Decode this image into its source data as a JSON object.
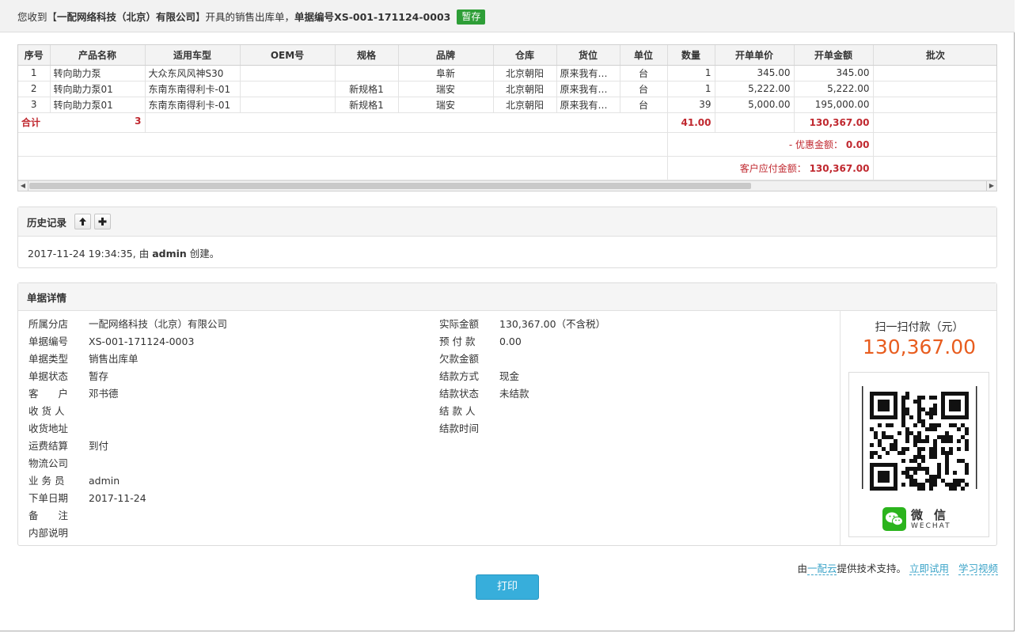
{
  "header": {
    "prefix": "您收到【",
    "company": "一配网络科技（北京）有限公司",
    "middle": "】开具的销售出库单，",
    "doc_label": "单据编号",
    "doc_no": "XS-001-171124-0003",
    "status_badge": "暂存"
  },
  "table": {
    "columns": [
      "序号",
      "产品名称",
      "适用车型",
      "OEM号",
      "规格",
      "品牌",
      "仓库",
      "货位",
      "单位",
      "数量",
      "开单单价",
      "开单金额",
      "批次"
    ],
    "rows": [
      [
        "1",
        "转向助力泵",
        "大众东风风神S30",
        "",
        "",
        "阜新",
        "北京朝阳",
        "原来我有一个",
        "台",
        "1",
        "345.00",
        "345.00",
        ""
      ],
      [
        "2",
        "转向助力泵01",
        "东南东南得利卡-01",
        "",
        "新规格1",
        "瑞安",
        "北京朝阳",
        "原来我有一个",
        "台",
        "1",
        "5,222.00",
        "5,222.00",
        ""
      ],
      [
        "3",
        "转向助力泵01",
        "东南东南得利卡-01",
        "",
        "新规格1",
        "瑞安",
        "北京朝阳",
        "原来我有一个",
        "台",
        "39",
        "5,000.00",
        "195,000.00",
        ""
      ]
    ],
    "total_label": "合计",
    "total_count": "3",
    "total_qty": "41.00",
    "total_amount": "130,367.00",
    "discount_label": "- 优惠金额：",
    "discount_value": "0.00",
    "payable_label": "客户应付金额：",
    "payable_value": "130,367.00"
  },
  "history": {
    "title": "历史记录",
    "time": "2017-11-24 19:34:35,",
    "by": "由",
    "user": "admin",
    "action": "创建。"
  },
  "detail": {
    "title": "单据详情",
    "left": [
      {
        "k": "所属分店",
        "v": "一配网络科技（北京）有限公司"
      },
      {
        "k": "单据编号",
        "v": "XS-001-171124-0003"
      },
      {
        "k": "单据类型",
        "v": "销售出库单"
      },
      {
        "k": "单据状态",
        "v": "暂存"
      },
      {
        "k": "客　　户",
        "v": "邓书德"
      },
      {
        "k": "收 货 人",
        "v": ""
      },
      {
        "k": "收货地址",
        "v": ""
      },
      {
        "k": "运费结算",
        "v": "到付"
      },
      {
        "k": "物流公司",
        "v": ""
      },
      {
        "k": "业 务 员",
        "v": "admin"
      },
      {
        "k": "下单日期",
        "v": "2017-11-24"
      },
      {
        "k": "备　　注",
        "v": ""
      },
      {
        "k": "内部说明",
        "v": ""
      }
    ],
    "mid": [
      {
        "k": "实际金额",
        "v": "130,367.00（不含税）"
      },
      {
        "k": "预 付 款",
        "v": "0.00"
      },
      {
        "k": "欠款金额",
        "v": ""
      },
      {
        "k": "结款方式",
        "v": "现金"
      },
      {
        "k": "结款状态",
        "v": "未结款"
      },
      {
        "k": "结 款 人",
        "v": ""
      },
      {
        "k": "结款时间",
        "v": ""
      }
    ],
    "qr_title": "扫一扫付款（元）",
    "qr_amount": "130,367.00",
    "wechat_cn": "微信",
    "wechat_en": "WECHAT"
  },
  "footer": {
    "credit_prefix": "由",
    "credit_link": "一配云",
    "credit_suffix": "提供技术支持。",
    "trial_link": "立即试用",
    "video_link": "学习视频",
    "print_label": "打印"
  }
}
